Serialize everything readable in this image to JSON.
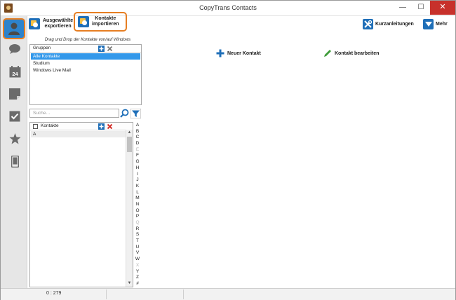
{
  "window": {
    "title": "CopyTrans Contacts",
    "min_glyph": "—",
    "max_glyph": "☐",
    "close_glyph": "✕"
  },
  "sidebar": {
    "items": [
      {
        "icon": "contacts-icon",
        "active": true
      },
      {
        "icon": "messages-icon",
        "active": false
      },
      {
        "icon": "calendar-icon",
        "active": false,
        "badge": "24"
      },
      {
        "icon": "notes-icon",
        "active": false
      },
      {
        "icon": "tasks-icon",
        "active": false
      },
      {
        "icon": "favorites-icon",
        "active": false
      },
      {
        "icon": "device-icon",
        "active": false
      }
    ]
  },
  "toolbar": {
    "export_label": "Ausgewählte\nexportieren",
    "import_label": "Kontakte\nimportieren",
    "guide_label": "Kurzanleitungen",
    "more_label": "Mehr"
  },
  "groups": {
    "hint": "Drag und Drop der Kontakte von/auf Windows",
    "header": "Gruppen",
    "items": [
      "Alle Kontakte",
      "Studium",
      "Windows Live Mail"
    ],
    "selected_index": 0
  },
  "search": {
    "placeholder": "Suche…"
  },
  "contacts": {
    "header": "Kontakte",
    "section": "A"
  },
  "alphabet": {
    "letters": [
      "A",
      "B",
      "C",
      "D",
      "E",
      "F",
      "G",
      "H",
      "I",
      "J",
      "K",
      "L",
      "M",
      "N",
      "O",
      "P",
      "Q",
      "R",
      "S",
      "T",
      "U",
      "V",
      "W",
      "X",
      "Y",
      "Z",
      "#"
    ],
    "dimmed": [
      "E",
      "Q",
      "X"
    ]
  },
  "main": {
    "new_contact_label": "Neuer Kontakt",
    "edit_contact_label": "Kontakt bearbeiten"
  },
  "status": {
    "count": "0 : 279"
  },
  "colors": {
    "accent": "#2d83cc",
    "highlight": "#e67e22",
    "selection": "#3398ea"
  }
}
